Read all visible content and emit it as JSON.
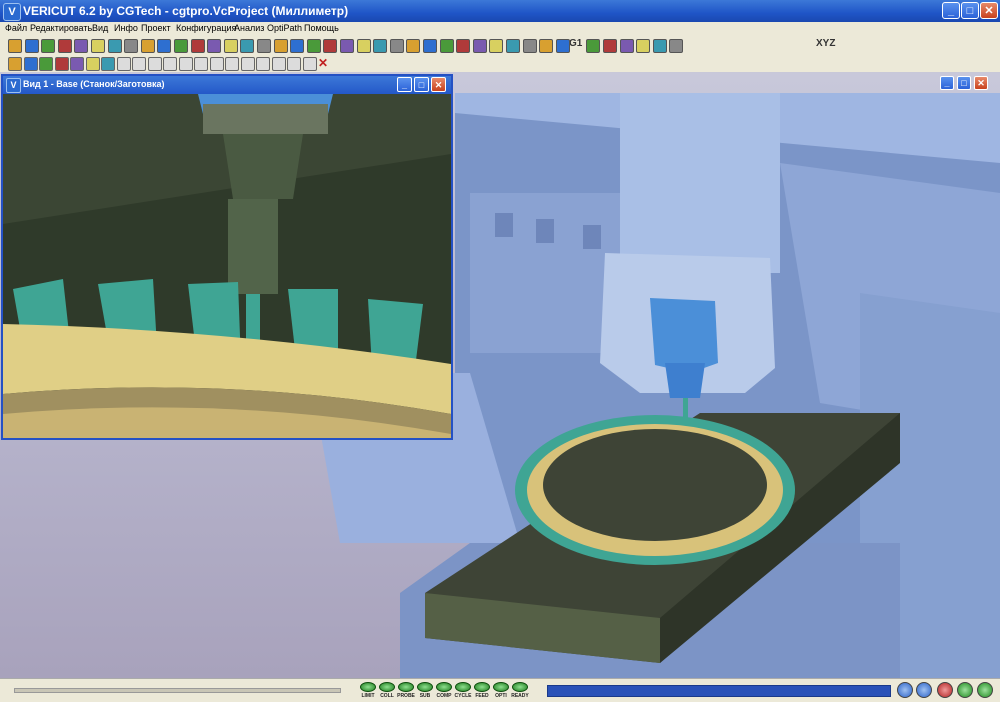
{
  "app": {
    "title": "VERICUT 6.2 by CGTech - cgtpro.VcProject (Миллиметр)",
    "logo_letter": "V",
    "controls": {
      "minimize": "_",
      "maximize": "□",
      "close": "✕"
    }
  },
  "menu": [
    "Файл",
    "Редактировать",
    "Вид",
    "Инфо",
    "Проект",
    "Конфигурация",
    "Анализ",
    "OptiPath",
    "Помощь"
  ],
  "toolbar": {
    "text_glyphs": {
      "g1": "G1",
      "xyz": "XYZ"
    },
    "icons_row1": [
      "open-file-icon",
      "save-icon",
      "save-as-icon",
      "folder-icon",
      "folder-open-icon",
      "export-icon",
      "document-icon",
      "copy-icon",
      "paste-icon",
      "layers-icon",
      "machine-icon",
      "tool-icon",
      "gear-icon",
      "settings-icon",
      "import-icon",
      "tree-icon",
      "component-icon",
      "model-icon",
      "fixture-icon",
      "coordinate-icon",
      "measure-icon",
      "axis-icon",
      "cube-icon",
      "program-icon",
      "simulate-icon",
      "report-icon",
      "probe-icon",
      "optipath-icon",
      "compare-icon",
      "analysis-icon",
      "section-icon",
      "camera-icon",
      "inspect-icon",
      "zoom-icon",
      "fit-icon",
      "rotate-icon",
      "pan-icon",
      "view-icon",
      "help-icon",
      "wizard-icon"
    ],
    "icons_row2": [
      "layout-icon",
      "flip-icon",
      "tile-icon",
      "arrange-icon",
      "window-icon",
      "split-icon",
      "grid-icon",
      "view-1-icon",
      "view-2-icon",
      "view-3-icon",
      "view-4-icon",
      "view-5-icon",
      "view-6-icon",
      "view-7-icon",
      "view-8-icon",
      "view-9-icon",
      "view-10-icon",
      "view-11-icon",
      "view-12-icon",
      "view-13-icon",
      "delete-icon"
    ]
  },
  "subwindow": {
    "title": "Вид 1 - Base (Станок/Заготовка)",
    "logo_letter": "V"
  },
  "status": {
    "leds": [
      "LIMIT",
      "COLL",
      "PROBE",
      "SUB",
      "COMP",
      "CYCLE",
      "FEED",
      "OPTI",
      "READY"
    ],
    "progress_fraction": 1.0,
    "controls": [
      "rewind-button",
      "stop-button",
      "record-button",
      "step-button",
      "play-button"
    ]
  },
  "colors": {
    "titlebar": "#2458c8",
    "menubar": "#ece9d8",
    "machine": "#8fa8d8",
    "table": "#3e4436",
    "gear_teeth": "#3fa594",
    "gear_ring": "#d8c27a",
    "tool_holder": "#4b8fd8",
    "led_green": "#2aa52a"
  }
}
